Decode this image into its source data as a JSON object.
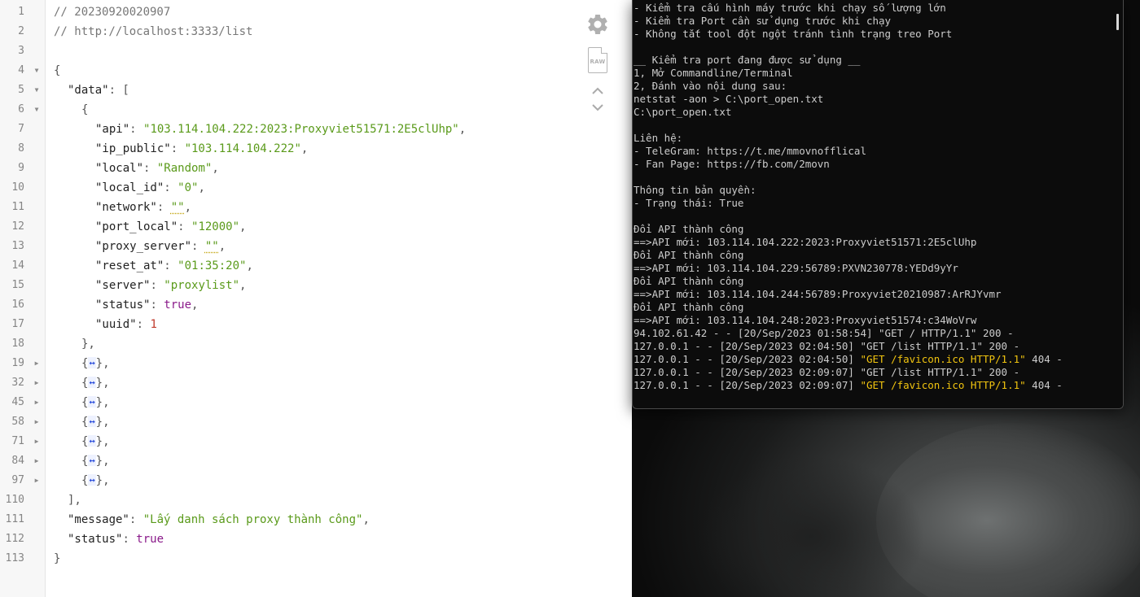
{
  "viewer": {
    "tools": {
      "settings_icon": "gear-icon",
      "raw_label": "RAW",
      "collapse_all_icon": "chevron-up-icon",
      "expand_all_icon": "chevron-down-icon"
    },
    "line_numbers": [
      "1",
      "2",
      "3",
      "4",
      "5",
      "6",
      "7",
      "8",
      "9",
      "10",
      "11",
      "12",
      "13",
      "14",
      "15",
      "16",
      "17",
      "18",
      "19",
      "32",
      "45",
      "58",
      "71",
      "84",
      "97",
      "110",
      "111",
      "112",
      "113"
    ],
    "comment_timestamp": "// 20230920020907",
    "comment_url": "// http://localhost:3333/list",
    "open_brace": "{",
    "data_key": "\"data\"",
    "data_open": ": [",
    "item_open": "{",
    "item_fields": [
      {
        "key": "\"api\"",
        "value": "\"103.114.104.222:2023:Proxyviet51571:2E5clUhp\"",
        "type": "string",
        "comma": ","
      },
      {
        "key": "\"ip_public\"",
        "value": "\"103.114.104.222\"",
        "type": "string",
        "comma": ","
      },
      {
        "key": "\"local\"",
        "value": "\"Random\"",
        "type": "string",
        "comma": ","
      },
      {
        "key": "\"local_id\"",
        "value": "\"0\"",
        "type": "string",
        "comma": ","
      },
      {
        "key": "\"network\"",
        "value": "\"\"",
        "type": "empty",
        "comma": ","
      },
      {
        "key": "\"port_local\"",
        "value": "\"12000\"",
        "type": "string",
        "comma": ","
      },
      {
        "key": "\"proxy_server\"",
        "value": "\"\"",
        "type": "empty",
        "comma": ","
      },
      {
        "key": "\"reset_at\"",
        "value": "\"01:35:20\"",
        "type": "string",
        "comma": ","
      },
      {
        "key": "\"server\"",
        "value": "\"proxylist\"",
        "type": "string",
        "comma": ","
      },
      {
        "key": "\"status\"",
        "value": "true",
        "type": "bool",
        "comma": ","
      },
      {
        "key": "\"uuid\"",
        "value": "1",
        "type": "number",
        "comma": ""
      }
    ],
    "item_close": "},",
    "collapsed_marker": "↔",
    "collapsed_items": [
      "{",
      "},"
    ],
    "data_close": "],",
    "message_key": "\"message\"",
    "message_value": "\"Lấy danh sách proxy thành công\"",
    "status_key": "\"status\"",
    "status_value": "true",
    "close_brace": "}",
    "sep": ": "
  },
  "terminal": {
    "lines": [
      "- Kiểm tra cấu hình máy trước khi chạy số lượng lớn",
      "- Kiểm tra Port cần sử dụng trước khi chạy",
      "- Không tắt tool đột ngột tránh tình trạng treo Port",
      "",
      "__ Kiểm tra port đang được sử dụng __",
      "1, Mở Commandline/Terminal",
      "2, Đánh vào nội dung sau:",
      "netstat -aon > C:\\port_open.txt",
      "C:\\port_open.txt",
      "",
      "Liên hệ:",
      "- TeleGram: https://t.me/mmovnofflical",
      "- Fan Page: https://fb.com/2movn",
      "",
      "Thông tin bản quyền:",
      "- Trạng thái: True",
      "",
      "Đổi API thành công",
      "==>API mới: 103.114.104.222:2023:Proxyviet51571:2E5clUhp",
      "Đổi API thành công",
      "==>API mới: 103.114.104.229:56789:PXVN230778:YEDd9yYr",
      "Đổi API thành công",
      "==>API mới: 103.114.104.244:56789:Proxyviet20210987:ArRJYvmr",
      "Đổi API thành công",
      "==>API mới: 103.114.104.248:2023:Proxyviet51574:c34WoVrw",
      "94.102.61.42 - - [20/Sep/2023 01:58:54] \"GET / HTTP/1.1\" 200 -"
    ],
    "log_lines": [
      {
        "prefix": "127.0.0.1 - - [20/Sep/2023 02:04:50] ",
        "request": "\"GET /list HTTP/1.1\"",
        "suffix": " 200 -",
        "highlight": false
      },
      {
        "prefix": "127.0.0.1 - - [20/Sep/2023 02:04:50] ",
        "request": "\"GET /favicon.ico HTTP/1.1\"",
        "suffix": " 404 -",
        "highlight": true
      },
      {
        "prefix": "127.0.0.1 - - [20/Sep/2023 02:09:07] ",
        "request": "\"GET /list HTTP/1.1\"",
        "suffix": " 200 -",
        "highlight": false
      },
      {
        "prefix": "127.0.0.1 - - [20/Sep/2023 02:09:07] ",
        "request": "\"GET /favicon.ico HTTP/1.1\"",
        "suffix": " 404 -",
        "highlight": true
      }
    ]
  },
  "colors": {
    "string": "#5a9a1a",
    "boolean": "#8a1a8a",
    "number": "#c0392b",
    "terminal_highlight": "#f1c40f"
  }
}
